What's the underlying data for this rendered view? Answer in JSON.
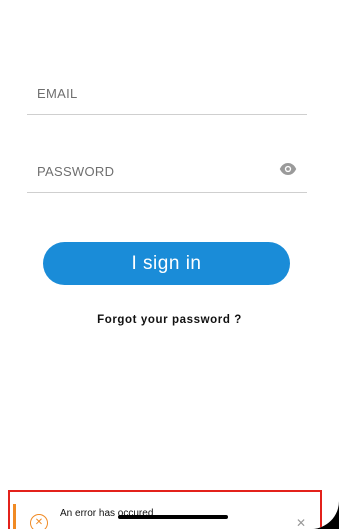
{
  "form": {
    "email_placeholder": "EMAIL",
    "password_placeholder": "PASSWORD",
    "signin_label": "I sign in",
    "forgot_label": "Forgot your password ?"
  },
  "toast": {
    "message": "An error has occured"
  },
  "colors": {
    "primary_button": "#1a8cd8",
    "error_outline": "#e3211b",
    "warning_accent": "#f08a24"
  },
  "icons": {
    "password_toggle": "eye-icon",
    "toast_status": "error-circle-icon",
    "toast_close": "close-icon"
  }
}
